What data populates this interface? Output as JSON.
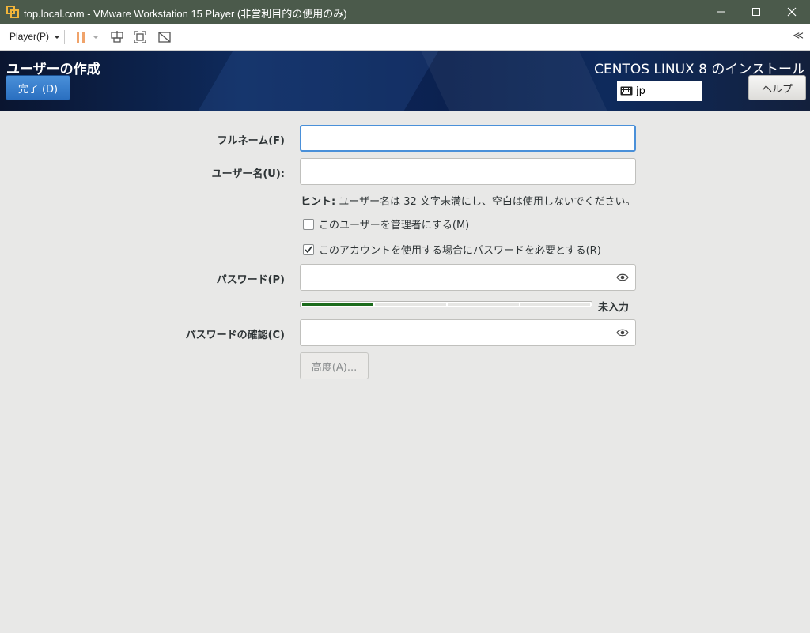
{
  "window": {
    "title": "top.local.com - VMware Workstation 15 Player (非営利目的の使用のみ)",
    "minimize_glyph": "—",
    "maximize_glyph": "☐",
    "close_glyph": "✕"
  },
  "toolbar": {
    "player_menu_label": "Player(P)",
    "collapse_glyph": "≪"
  },
  "header": {
    "spoke_title": "ユーザーの作成",
    "done_label": "完了 (D)",
    "product_title": "CENTOS LINUX 8 のインストール",
    "keyboard_layout": "jp",
    "help_label": "ヘルプ"
  },
  "form": {
    "fullname_label": "フルネーム(F)",
    "fullname_value": "",
    "username_label": "ユーザー名(U):",
    "username_value": "",
    "hint_prefix": "ヒント:",
    "hint_text": " ユーザー名は 32 文字未満にし、空白は使用しないでください。",
    "admin_check_label": "このユーザーを管理者にする(M)",
    "admin_checked": false,
    "require_password_label": "このアカウントを使用する場合にパスワードを必要とする(R)",
    "require_password_checked": true,
    "password_label": "パスワード(P)",
    "password_value": "",
    "strength_label": "未入力",
    "strength_level": 0.25,
    "confirm_label": "パスワードの確認(C)",
    "confirm_value": "",
    "advanced_label": "高度(A)..."
  },
  "colors": {
    "accent": "#4a90d9",
    "strength_fill": "#1c6b1c",
    "pause_icon": "#f0a36a"
  }
}
